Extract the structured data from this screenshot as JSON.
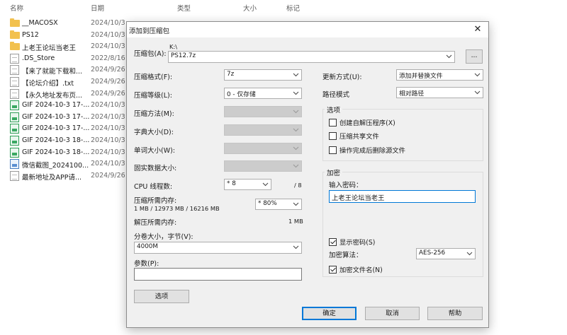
{
  "explorer": {
    "columns": {
      "name": "名称",
      "date": "日期",
      "type": "类型",
      "size": "大小",
      "tags": "标记"
    },
    "files": [
      {
        "icon": "folder-icon",
        "name": "__MACOSX",
        "date": "2024/10/3"
      },
      {
        "icon": "folder-icon",
        "name": "PS12",
        "date": "2024/10/3"
      },
      {
        "icon": "folder-icon",
        "name": "上老王论坛当老王",
        "date": "2024/10/3"
      },
      {
        "icon": "document-icon",
        "name": ".DS_Store",
        "date": "2022/8/16"
      },
      {
        "icon": "document-icon",
        "name": "【来了就能下载和...",
        "date": "2024/9/26"
      },
      {
        "icon": "document-icon",
        "name": "【论坛介绍】.txt",
        "date": "2024/9/26"
      },
      {
        "icon": "document-icon",
        "name": "【永久地址发布页...",
        "date": "2024/9/26"
      },
      {
        "icon": "gif-icon",
        "name": "GIF 2024-10-3 17-...",
        "date": "2024/10/3"
      },
      {
        "icon": "gif-icon",
        "name": "GIF 2024-10-3 17-...",
        "date": "2024/10/3"
      },
      {
        "icon": "gif-icon",
        "name": "GIF 2024-10-3 17-...",
        "date": "2024/10/3"
      },
      {
        "icon": "gif-icon",
        "name": "GIF 2024-10-3 18-...",
        "date": "2024/10/3"
      },
      {
        "icon": "gif-icon",
        "name": "GIF 2024-10-3 18-...",
        "date": "2024/10/3"
      },
      {
        "icon": "image-icon",
        "name": "微信截图_2024100...",
        "date": "2024/10/3"
      },
      {
        "icon": "document-icon",
        "name": "最新地址及APP请...",
        "date": "2024/9/26"
      }
    ]
  },
  "dialog": {
    "title": "添加到压缩包",
    "close_glyph": "✕",
    "archive": {
      "label": "压缩包(A):",
      "path": "K:\\",
      "value": "PS12.7z",
      "browse_label": "..."
    },
    "left": {
      "format": {
        "label": "压缩格式(F):",
        "value": "7z"
      },
      "level": {
        "label": "压缩等级(L):",
        "value": "0 - 仅存储"
      },
      "method": {
        "label": "压缩方法(M):",
        "value": ""
      },
      "dict": {
        "label": "字典大小(D):",
        "value": ""
      },
      "word": {
        "label": "单词大小(W):",
        "value": ""
      },
      "solid": {
        "label": "固实数据大小:",
        "value": ""
      },
      "threads": {
        "label": "CPU 线程数:",
        "value": "* 8",
        "max": "/ 8"
      },
      "mem_compress": {
        "label": "压缩所需内存:",
        "detail": "1 MB / 12973 MB / 16216 MB",
        "value": "* 80%"
      },
      "mem_decompress": {
        "label": "解压所需内存:",
        "value": "1 MB"
      },
      "volume": {
        "label": "分卷大小，字节(V):",
        "value": "4000M"
      },
      "params": {
        "label": "参数(P):",
        "value": ""
      },
      "options_button": "选项"
    },
    "right": {
      "update": {
        "label": "更新方式(U):",
        "value": "添加并替换文件"
      },
      "path_mode": {
        "label": "路径模式",
        "value": "相对路径"
      },
      "options_group": {
        "title": "选项",
        "sfx": {
          "label": "创建自解压程序(X)",
          "checked": false
        },
        "shared": {
          "label": "压缩共享文件",
          "checked": false
        },
        "delete": {
          "label": "操作完成后删除源文件",
          "checked": false
        }
      },
      "encryption": {
        "title": "加密",
        "password_label": "输入密码：",
        "password_value": "上老王论坛当老王",
        "show_password": {
          "label": "显示密码(S)",
          "checked": true
        },
        "method_label": "加密算法：",
        "method_value": "AES-256",
        "encrypt_names": {
          "label": "加密文件名(N)",
          "checked": true
        }
      }
    },
    "buttons": {
      "ok": "确定",
      "cancel": "取消",
      "help": "帮助"
    }
  },
  "colors": {
    "accent": "#0078d7",
    "dialog_bg": "#f0f0f0",
    "disabled_combo": "#cccccc"
  }
}
